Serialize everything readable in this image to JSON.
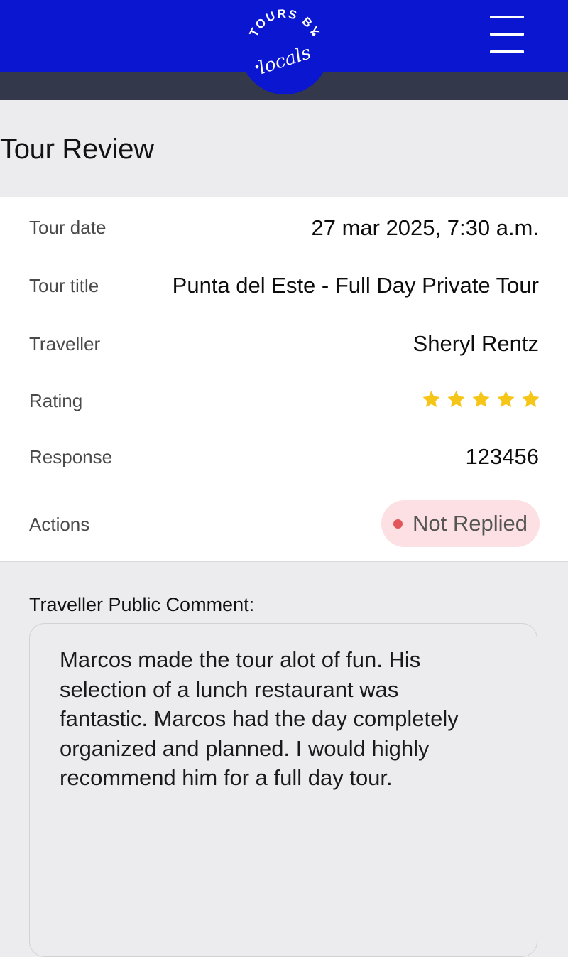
{
  "header": {
    "logo_text_top": "TOURS BY",
    "logo_text_script": "locals",
    "menu_icon": "hamburger-menu-icon",
    "colors": {
      "primary": "#0a16cf",
      "subbar": "#33394b"
    }
  },
  "page": {
    "title": "Tour Review"
  },
  "details": {
    "tour_date": {
      "label": "Tour date",
      "value": "27 mar 2025, 7:30 a.m."
    },
    "tour_title": {
      "label": "Tour title",
      "value": "Punta del Este - Full Day Private Tour"
    },
    "traveller": {
      "label": "Traveller",
      "value": "Sheryl Rentz"
    },
    "rating": {
      "label": "Rating",
      "stars": 5,
      "max": 5,
      "icon": "star-icon",
      "color": "#f5c518"
    },
    "response": {
      "label": "Response",
      "value": "123456"
    },
    "actions": {
      "label": "Actions",
      "status": "Not Replied",
      "status_color": "#e2555b",
      "pill_bg": "#fde0e3"
    }
  },
  "comment": {
    "label": "Traveller Public Comment:",
    "text": "Marcos made the tour alot of fun.  His\nselection of a lunch restaurant was\nfantastic.  Marcos had the day completely\norganized and planned.  I would highly\nrecommend him for a full day tour."
  }
}
